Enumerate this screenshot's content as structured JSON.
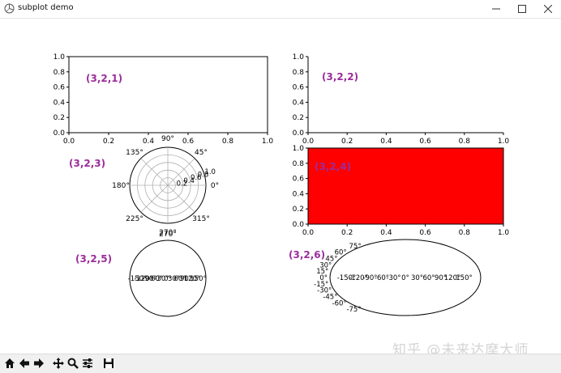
{
  "window": {
    "title": "subplot demo",
    "minimize_icon": "minimize-icon",
    "maximize_icon": "maximize-icon",
    "close_icon": "close-icon"
  },
  "toolbar": {
    "buttons": [
      "home-icon",
      "back-arrow-icon",
      "forward-arrow-icon",
      "pan-icon",
      "zoom-icon",
      "configure-subplots-icon",
      "save-icon"
    ]
  },
  "watermark": "知乎 @未来达摩大师",
  "colors": {
    "fill_red": "#ff0000",
    "label_purple": "#9b2d9b"
  },
  "chart_data": [
    {
      "type": "table",
      "label": "(3,2,1)",
      "ylim": [
        0.0,
        1.0
      ],
      "xlim": [
        0.0,
        1.0
      ],
      "yticks": [
        "0.0",
        "0.2",
        "0.4",
        "0.6",
        "0.8",
        "1.0"
      ],
      "xticks": [
        "0.0",
        "0.2",
        "0.4",
        "0.6",
        "0.8",
        "1.0"
      ]
    },
    {
      "type": "table",
      "label": "(3,2,2)",
      "ylim": [
        0.0,
        1.0
      ],
      "xlim": [
        0.0,
        1.0
      ],
      "yticks": [
        "0.0",
        "0.2",
        "0.4",
        "0.6",
        "0.8",
        "1.0"
      ],
      "xticks": [
        "0.0",
        "0.2",
        "0.4",
        "0.6",
        "0.8",
        "1.0"
      ],
      "frame": "left and bottom spines only"
    },
    {
      "type": "polar",
      "label": "(3,2,3)",
      "angle_ticks": [
        "0°",
        "45°",
        "90°",
        "135°",
        "180°",
        "225°",
        "270°",
        "315°"
      ],
      "radial_ticks": [
        "0.2",
        "0.4",
        "0.6",
        "0.8",
        "1.0"
      ],
      "grid": true
    },
    {
      "type": "area",
      "label": "(3,2,4)",
      "ylim": [
        0.0,
        1.0
      ],
      "xlim": [
        0.0,
        1.0
      ],
      "yticks": [
        "0.0",
        "0.2",
        "0.4",
        "0.6",
        "0.8",
        "1.0"
      ],
      "xticks": [
        "0.0",
        "0.2",
        "0.4",
        "0.6",
        "0.8",
        "1.0"
      ],
      "facecolor": "red"
    },
    {
      "type": "projection",
      "label": "(3,2,5)",
      "xticks": [
        "-150°",
        "-120°",
        "-90°",
        "-60°",
        "-30°",
        "0°",
        "30°",
        "60°",
        "90°",
        "120°",
        "150°"
      ]
    },
    {
      "type": "projection",
      "label": "(3,2,6)",
      "xticks": [
        "-150°",
        "-120°",
        "-90°",
        "-60°",
        "-30°",
        "0°",
        "30°",
        "60°",
        "90°",
        "120°",
        "150°"
      ],
      "yticks": [
        "75°",
        "60°",
        "45°",
        "30°",
        "15°",
        "0°",
        "-15°",
        "-30°",
        "-45°",
        "-60°",
        "-75°"
      ]
    }
  ]
}
